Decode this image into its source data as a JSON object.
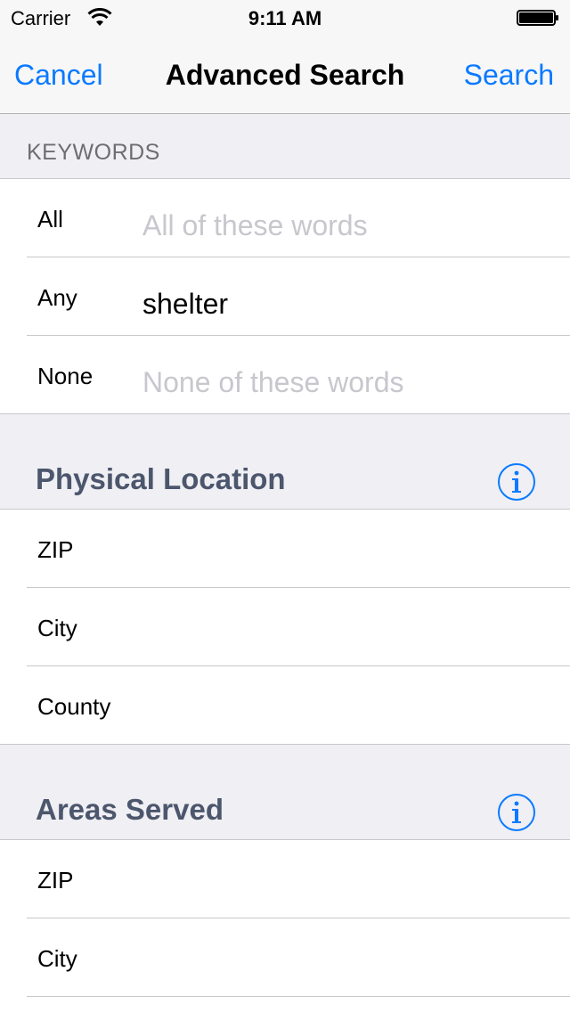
{
  "status_bar": {
    "carrier": "Carrier",
    "time": "9:11 AM"
  },
  "nav": {
    "cancel": "Cancel",
    "title": "Advanced Search",
    "search": "Search"
  },
  "keywords": {
    "header": "KEYWORDS",
    "rows": [
      {
        "label": "All",
        "value": "",
        "placeholder": "All of these words"
      },
      {
        "label": "Any",
        "value": "shelter",
        "placeholder": ""
      },
      {
        "label": "None",
        "value": "",
        "placeholder": "None of these words"
      }
    ]
  },
  "physical_location": {
    "header": "Physical Location",
    "rows": [
      {
        "label": "ZIP"
      },
      {
        "label": "City"
      },
      {
        "label": "County"
      }
    ]
  },
  "areas_served": {
    "header": "Areas Served",
    "rows": [
      {
        "label": "ZIP"
      },
      {
        "label": "City"
      }
    ]
  },
  "colors": {
    "accent": "#0a7aff",
    "section_title": "#4c566c",
    "placeholder": "#c7c7cd"
  }
}
